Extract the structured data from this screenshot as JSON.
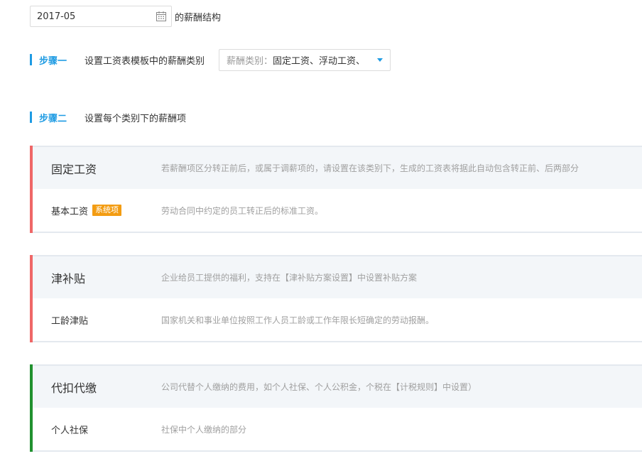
{
  "period": {
    "value": "2017-05",
    "suffix": "的薪酬结构",
    "icon": "calendar-icon"
  },
  "step1": {
    "label": "步骤一",
    "text": "设置工资表模板中的薪酬类别",
    "select": {
      "prefix": "薪酬类别：",
      "value": "固定工资、浮动工资、",
      "icon": "caret-down-icon"
    }
  },
  "step2": {
    "label": "步骤二",
    "text": "设置每个类别下的薪酬项"
  },
  "colors": {
    "accent_blue": "#1e9be3",
    "category_red": "#ef6767",
    "category_green": "#21912f",
    "badge_orange": "#f39c12"
  },
  "categories": [
    {
      "title": "固定工资",
      "description": "若薪酬项区分转正前后，或属于调薪项的，请设置在该类别下，生成的工资表将据此自动包含转正前、后两部分",
      "item": {
        "name": "基本工资",
        "badge": "系统项",
        "description": "劳动合同中约定的员工转正后的标准工资。"
      }
    },
    {
      "title": "津补贴",
      "description": "企业给员工提供的福利，支持在【津补贴方案设置】中设置补贴方案",
      "item": {
        "name": "工龄津贴",
        "description": "国家机关和事业单位按照工作人员工龄或工作年限长短确定的劳动报酬。"
      }
    },
    {
      "title": "代扣代缴",
      "description": "公司代替个人缴纳的费用，如个人社保、个人公积金，个税在【计税规则】中设置）",
      "item": {
        "name": "个人社保",
        "description": "社保中个人缴纳的部分"
      }
    }
  ]
}
